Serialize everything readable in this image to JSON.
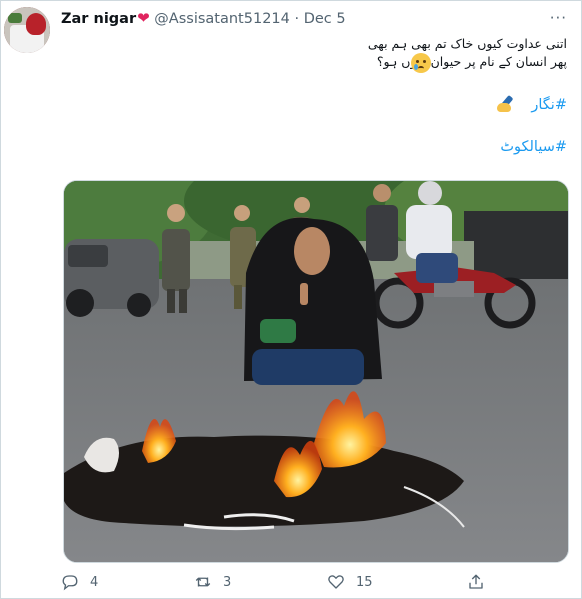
{
  "tweet": {
    "author_name": "Zar nigar",
    "author_emoji": "❤",
    "handle": "@Assisatant51214",
    "separator": "·",
    "date": "Dec 5",
    "more_glyph": "···",
    "text_line1": "اتنی عداوت کیوں خاک تم بھی ہم بھی",
    "text_line2": "پھر انسان کے نام پر حیوان کیوں ہو؟",
    "hashtag1": "#نگار",
    "hashtag2": "#سیالکوٹ"
  },
  "actions": {
    "replies": "4",
    "retweets": "3",
    "likes": "15"
  },
  "colors": {
    "link": "#1d9bf0",
    "muted": "#536471",
    "heart": "#e0245e"
  },
  "icons": [
    "reply-icon",
    "retweet-icon",
    "like-icon",
    "share-icon"
  ]
}
